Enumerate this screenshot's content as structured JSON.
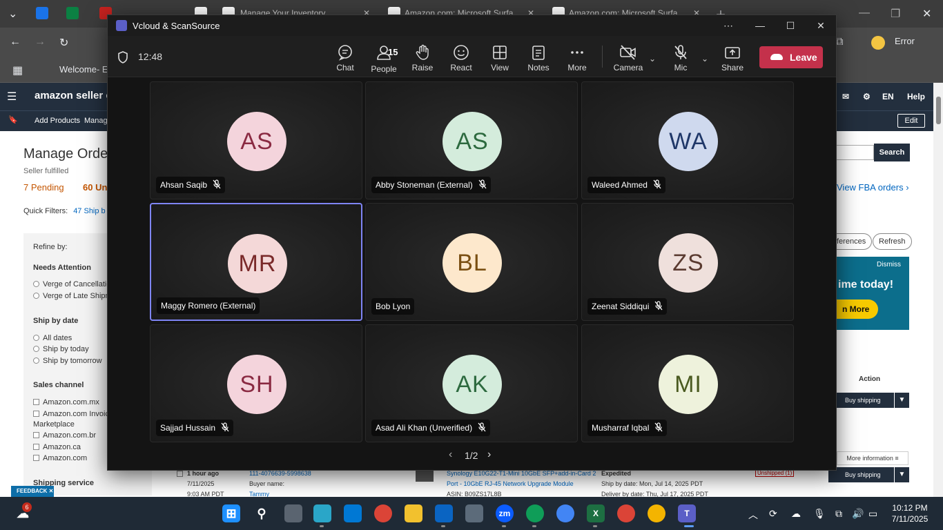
{
  "browser": {
    "tabs": [
      {
        "title": "Manage Your Inventory"
      },
      {
        "title": "Amazon.com: Microsoft Surfa"
      },
      {
        "title": "Amazon.com: Microsoft Surfa"
      }
    ],
    "profile_status": "Error",
    "bookmark": "Welcome- EC"
  },
  "amazon": {
    "logo": "amazon seller cent",
    "nav": [
      "Add Products",
      "Manag"
    ],
    "header_right": {
      "lang": "EN",
      "help": "Help",
      "edit": "Edit"
    },
    "page_title": "Manage Orde",
    "subtitle": "Seller fulfilled",
    "tabs": [
      {
        "label": "7 Pending"
      },
      {
        "label": "60 Un"
      }
    ],
    "quick_filters_label": "Quick Filters:",
    "quick_filter": "47 Ship b",
    "refine": {
      "title": "Refine by:",
      "needs_attention": {
        "heading": "Needs Attention",
        "options": [
          "Verge of Cancellatio",
          "Verge of Late Shipm"
        ]
      },
      "ship_by": {
        "heading": "Ship by date",
        "options": [
          "All dates",
          "Ship by today",
          "Ship by tomorrow"
        ]
      },
      "sales_channel": {
        "heading": "Sales channel",
        "options": [
          "Amazon.com.mx",
          "Amazon.com Invoic",
          "Marketplace",
          "Amazon.com.br",
          "Amazon.ca",
          "Amazon.com"
        ]
      },
      "shipping_service": "Shipping service"
    },
    "search_button": "Search",
    "view_fba": "View FBA orders ›",
    "preferences": "ferences",
    "refresh": "Refresh",
    "promo": {
      "dismiss": "Dismiss",
      "headline": "ime today!",
      "button": "n More"
    },
    "action_header": "Action",
    "buy_shipping": "Buy shipping",
    "more_information": "More information ≡",
    "order_row": {
      "time": "1 hour ago",
      "date": "7/11/2025",
      "clock": "9:03 AM PDT",
      "order_id": "111-4076639-5998638",
      "buyer_label": "Buyer name:",
      "buyer": "Tammy",
      "product": "Synology E10G22-T1-Mini 10GbE SFP+add-in-Card 2",
      "product2": "Port - 10GbE RJ-45 Network Upgrade Module",
      "asin": "ASIN: B09ZS17L8B",
      "service": "Expedited",
      "ship_by": "Ship by date: Mon, Jul 14, 2025 PDT",
      "deliver_by": "Deliver by date: Thu, Jul 17, 2025 PDT",
      "status": "Unshipped (1)"
    },
    "feedback": "FEEDBACK ✕"
  },
  "teams": {
    "window_title": "Vcloud & ScanSource",
    "call_time": "12:48",
    "controls": {
      "chat": "Chat",
      "people": "People",
      "people_count": "15",
      "raise": "Raise",
      "react": "React",
      "view": "View",
      "notes": "Notes",
      "more": "More",
      "camera": "Camera",
      "mic": "Mic",
      "share": "Share",
      "leave": "Leave"
    },
    "participants": [
      {
        "initials": "AS",
        "name": "Ahsan Saqib",
        "muted": true,
        "bg": "#f4d4dc",
        "fg": "#8a2a42"
      },
      {
        "initials": "AS",
        "name": "Abby Stoneman (External)",
        "muted": true,
        "bg": "#d4ecdc",
        "fg": "#2d6a3f"
      },
      {
        "initials": "WA",
        "name": "Waleed Ahmed",
        "muted": true,
        "bg": "#cfd9ee",
        "fg": "#1f3768"
      },
      {
        "initials": "MR",
        "name": "Maggy Romero (External)",
        "muted": false,
        "bg": "#f4d8d8",
        "fg": "#7a2a2a"
      },
      {
        "initials": "BL",
        "name": "Bob Lyon",
        "muted": false,
        "bg": "#fde8cc",
        "fg": "#7a4f12"
      },
      {
        "initials": "ZS",
        "name": "Zeenat Siddiqui",
        "muted": true,
        "bg": "#efe0dc",
        "fg": "#5a3a30"
      },
      {
        "initials": "SH",
        "name": "Sajjad Hussain",
        "muted": true,
        "bg": "#f4d4dc",
        "fg": "#8a2a42"
      },
      {
        "initials": "AK",
        "name": "Asad Ali Khan (Unverified)",
        "muted": true,
        "bg": "#d4ecdc",
        "fg": "#2d6a3f"
      },
      {
        "initials": "MI",
        "name": "Musharraf Iqbal",
        "muted": true,
        "bg": "#eef2dc",
        "fg": "#4a5a20"
      }
    ],
    "page_indicator": "1/2"
  },
  "taskbar": {
    "time": "10:12 PM",
    "date": "7/11/2025",
    "widget_badge": "6"
  }
}
